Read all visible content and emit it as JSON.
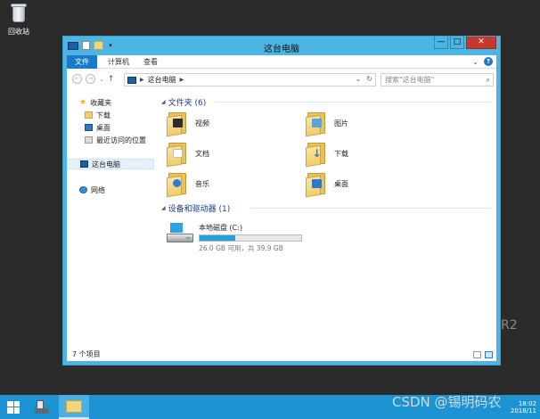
{
  "desktop": {
    "recycle_bin_label": "回收站",
    "edition_text": "R2"
  },
  "window": {
    "title": "这台电脑",
    "controls": {
      "minimize": "—",
      "maximize": "□",
      "close": "✕"
    }
  },
  "ribbon": {
    "tabs": [
      {
        "label": "文件"
      },
      {
        "label": "计算机"
      },
      {
        "label": "查看"
      }
    ],
    "help": "?"
  },
  "address_bar": {
    "location": "这台电脑",
    "search_placeholder": "搜索\"这台电脑\""
  },
  "nav_pane": {
    "favorites": "收藏夹",
    "favorites_items": [
      {
        "label": "下载"
      },
      {
        "label": "桌面"
      },
      {
        "label": "最近访问的位置"
      }
    ],
    "this_pc": "这台电脑",
    "network": "网络"
  },
  "content": {
    "folders_header": "文件夹 (6)",
    "folders": [
      {
        "label": "视频"
      },
      {
        "label": "图片"
      },
      {
        "label": "文档"
      },
      {
        "label": "下载"
      },
      {
        "label": "音乐"
      },
      {
        "label": "桌面"
      }
    ],
    "devices_header": "设备和驱动器 (1)",
    "drive": {
      "name": "本地磁盘 (C:)",
      "space": "26.0 GB 可用，共 39.9 GB",
      "used_fraction": 0.35
    }
  },
  "statusbar": {
    "item_count": "7 个项目"
  },
  "taskbar": {
    "clock_time": "18:02",
    "clock_date": "2018/11"
  },
  "watermark": "CSDN @锡明码农",
  "colors": {
    "window_frame": "#4db5e1",
    "taskbar": "#1c94d4",
    "file_tab": "#1979ca",
    "close_button": "#c7392f",
    "drive_bar": "#26a0da"
  }
}
